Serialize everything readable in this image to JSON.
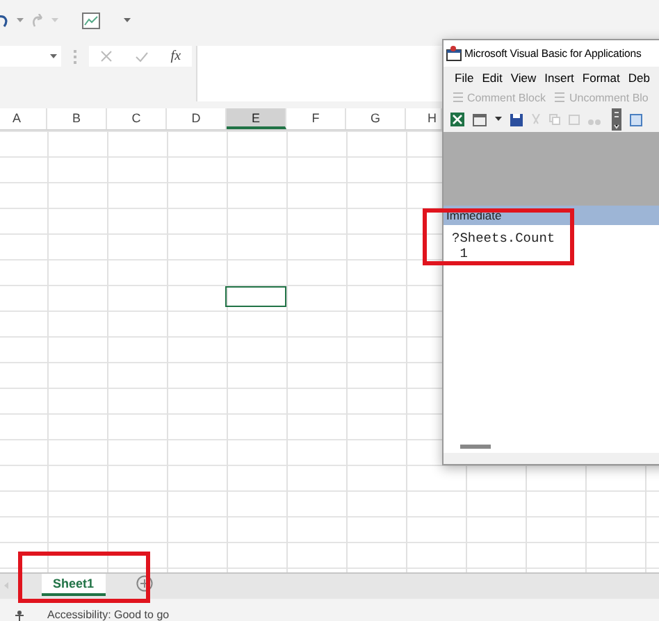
{
  "formula_bar": {
    "function_label": "fx"
  },
  "columns": [
    {
      "label": "A",
      "selected": false
    },
    {
      "label": "B",
      "selected": false
    },
    {
      "label": "C",
      "selected": false
    },
    {
      "label": "D",
      "selected": false
    },
    {
      "label": "E",
      "selected": true
    },
    {
      "label": "F",
      "selected": false
    },
    {
      "label": "G",
      "selected": false
    },
    {
      "label": "H",
      "selected": false
    }
  ],
  "sheet_tabs": [
    {
      "label": "Sheet1",
      "selected": true
    }
  ],
  "status_bar": {
    "text": "Accessibility: Good to go"
  },
  "vba_window": {
    "title": "Microsoft Visual Basic for Applications",
    "menu": [
      "File",
      "Edit",
      "View",
      "Insert",
      "Format",
      "Deb"
    ],
    "edit_toolbar": [
      {
        "label": "Comment Block",
        "disabled": true
      },
      {
        "label": "Uncomment Blo",
        "disabled": true
      }
    ],
    "immediate": {
      "title": "Immediate",
      "lines": [
        "?Sheets.Count",
        " 1"
      ]
    }
  }
}
